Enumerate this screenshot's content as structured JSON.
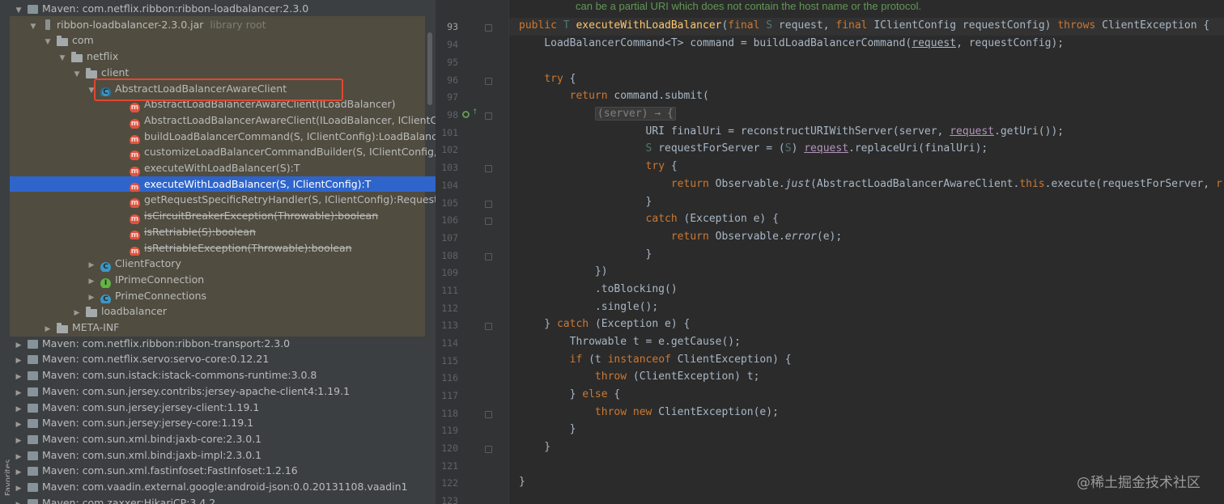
{
  "sidebar": {
    "favorites_label": "Favorites"
  },
  "tree": {
    "rows": [
      {
        "indent": 1,
        "arrow": "open",
        "icon": "maven",
        "text": "Maven: com.netflix.ribbon:ribbon-loadbalancer:2.3.0"
      },
      {
        "indent": 2,
        "arrow": "open",
        "icon": "jar",
        "text": "ribbon-loadbalancer-2.3.0.jar",
        "hint": "library root"
      },
      {
        "indent": 3,
        "arrow": "open",
        "icon": "folder",
        "text": "com"
      },
      {
        "indent": 4,
        "arrow": "open",
        "icon": "folder",
        "text": "netflix"
      },
      {
        "indent": 5,
        "arrow": "open",
        "icon": "folder",
        "text": "client"
      },
      {
        "indent": 6,
        "arrow": "open",
        "icon": "class-abstract",
        "text": "AbstractLoadBalancerAwareClient"
      },
      {
        "indent": 8,
        "arrow": "none",
        "icon": "method",
        "text": "AbstractLoadBalancerAwareClient(ILoadBalancer)"
      },
      {
        "indent": 8,
        "arrow": "none",
        "icon": "method",
        "text": "AbstractLoadBalancerAwareClient(ILoadBalancer, IClientConfig)"
      },
      {
        "indent": 8,
        "arrow": "none",
        "icon": "method",
        "text": "buildLoadBalancerCommand(S, IClientConfig):LoadBalancerCommand<T>"
      },
      {
        "indent": 8,
        "arrow": "none",
        "icon": "method",
        "text": "customizeLoadBalancerCommandBuilder(S, IClientConfig, Builder<T>):void"
      },
      {
        "indent": 8,
        "arrow": "none",
        "icon": "method",
        "text": "executeWithLoadBalancer(S):T"
      },
      {
        "indent": 8,
        "arrow": "none",
        "icon": "method",
        "text": "executeWithLoadBalancer(S, IClientConfig):T",
        "selected": true
      },
      {
        "indent": 8,
        "arrow": "none",
        "icon": "method",
        "text": "getRequestSpecificRetryHandler(S, IClientConfig):RequestSpecificRetryHandler"
      },
      {
        "indent": 8,
        "arrow": "none",
        "icon": "method",
        "text": "isCircuitBreakerException(Throwable):boolean",
        "deprecated": true
      },
      {
        "indent": 8,
        "arrow": "none",
        "icon": "method",
        "text": "isRetriable(S):boolean",
        "deprecated": true
      },
      {
        "indent": 8,
        "arrow": "none",
        "icon": "method",
        "text": "isRetriableException(Throwable):boolean",
        "deprecated": true
      },
      {
        "indent": 6,
        "arrow": "closed",
        "icon": "class",
        "text": "ClientFactory"
      },
      {
        "indent": 6,
        "arrow": "closed",
        "icon": "interface",
        "text": "IPrimeConnection"
      },
      {
        "indent": 6,
        "arrow": "closed",
        "icon": "class",
        "text": "PrimeConnections"
      },
      {
        "indent": 5,
        "arrow": "closed",
        "icon": "folder",
        "text": "loadbalancer"
      },
      {
        "indent": 3,
        "arrow": "closed",
        "icon": "folder",
        "text": "META-INF"
      },
      {
        "indent": 1,
        "arrow": "closed",
        "icon": "maven",
        "text": "Maven: com.netflix.ribbon:ribbon-transport:2.3.0"
      },
      {
        "indent": 1,
        "arrow": "closed",
        "icon": "maven",
        "text": "Maven: com.netflix.servo:servo-core:0.12.21"
      },
      {
        "indent": 1,
        "arrow": "closed",
        "icon": "maven",
        "text": "Maven: com.sun.istack:istack-commons-runtime:3.0.8"
      },
      {
        "indent": 1,
        "arrow": "closed",
        "icon": "maven",
        "text": "Maven: com.sun.jersey.contribs:jersey-apache-client4:1.19.1"
      },
      {
        "indent": 1,
        "arrow": "closed",
        "icon": "maven",
        "text": "Maven: com.sun.jersey:jersey-client:1.19.1"
      },
      {
        "indent": 1,
        "arrow": "closed",
        "icon": "maven",
        "text": "Maven: com.sun.jersey:jersey-core:1.19.1"
      },
      {
        "indent": 1,
        "arrow": "closed",
        "icon": "maven",
        "text": "Maven: com.sun.xml.bind:jaxb-core:2.3.0.1"
      },
      {
        "indent": 1,
        "arrow": "closed",
        "icon": "maven",
        "text": "Maven: com.sun.xml.bind:jaxb-impl:2.3.0.1"
      },
      {
        "indent": 1,
        "arrow": "closed",
        "icon": "maven",
        "text": "Maven: com.sun.xml.fastinfoset:FastInfoset:1.2.16"
      },
      {
        "indent": 1,
        "arrow": "closed",
        "icon": "maven",
        "text": "Maven: com.vaadin.external.google:android-json:0.0.20131108.vaadin1"
      },
      {
        "indent": 1,
        "arrow": "closed",
        "icon": "maven",
        "text": "Maven: com.zaxxer:HikariCP:3.4.2"
      }
    ]
  },
  "editor": {
    "doc_comment": "can be a partial URI which does not contain the host name or the protocol.",
    "line_numbers": [
      "93",
      "94",
      "95",
      "96",
      "97",
      "98",
      "101",
      "102",
      "103",
      "104",
      "105",
      "106",
      "107",
      "108",
      "109",
      "111",
      "112",
      "113",
      "114",
      "115",
      "116",
      "117",
      "118",
      "119",
      "120",
      "121",
      "122",
      "123"
    ],
    "lines": {
      "l93": {
        "a": "public ",
        "b": "T ",
        "c": "executeWithLoadBalancer",
        "d": "(",
        "e": "final ",
        "f": "S ",
        "g": "request, ",
        "h": "final ",
        "i": "IClientConfig requestConfig) ",
        "j": "throws ",
        "k": "ClientException {"
      },
      "l94": {
        "a": "    LoadBalancerCommand<T> command = buildLoadBalancerCommand(",
        "b": "request",
        "c": ", requestConfig);"
      },
      "l96": {
        "a": "    ",
        "b": "try ",
        "c": "{"
      },
      "l97": {
        "a": "        ",
        "b": "return ",
        "c": "command.submit("
      },
      "l98": {
        "a": "            ",
        "b": "(server) → {"
      },
      "l101": {
        "a": "                    URI finalUri = reconstructURIWithServer(server, ",
        "b": "request",
        ".": "",
        "c": ".getUri());"
      },
      "l102": {
        "a": "                    ",
        "b": "S ",
        "c": "requestForServer = (",
        "d": "S",
        "e": ") ",
        "f": "request",
        "g": ".replaceUri(finalUri);"
      },
      "l103": {
        "a": "                    ",
        "b": "try ",
        "c": "{"
      },
      "l104": {
        "a": "                        ",
        "b": "return ",
        "c": "Observable.",
        "d": "just",
        "e": "(AbstractLoadBalancerAwareClient.",
        "f": "this",
        ".": "",
        "g": ".execute(requestForServer, ",
        "h": "r"
      },
      "l105": {
        "a": "                    }"
      },
      "l106": {
        "a": "                    ",
        "b": "catch ",
        "c": "(Exception e) {"
      },
      "l107": {
        "a": "                        ",
        "b": "return ",
        "c": "Observable.",
        "d": "error",
        "e": "(e);"
      },
      "l108": {
        "a": "                    }"
      },
      "l109": {
        "a": "            })"
      },
      "l111": {
        "a": "            .toBlocking()"
      },
      "l112": {
        "a": "            .single();"
      },
      "l113": {
        "a": "    } ",
        "b": "catch ",
        "c": "(Exception e) {"
      },
      "l114": {
        "a": "        Throwable t = e.getCause();"
      },
      "l115": {
        "a": "        ",
        "b": "if ",
        "c": "(t ",
        "d": "instanceof ",
        "e": "ClientException) {"
      },
      "l116": {
        "a": "            ",
        "b": "throw ",
        "c": "(ClientException) t;"
      },
      "l117": {
        "a": "        } ",
        "b": "else ",
        "c": "{"
      },
      "l118": {
        "a": "            ",
        "b": "throw new ",
        "c": "ClientException(e);"
      },
      "l119": {
        "a": "        }"
      },
      "l120": {
        "a": "    }"
      },
      "l122": {
        "a": "}"
      }
    }
  },
  "watermark": "@稀土掘金技术社区",
  "colors": {
    "selection": "#2f65ca",
    "highlight_box": "#e2462f",
    "keyword": "#cc7832",
    "function": "#ffc66d",
    "doc_comment": "#629755"
  }
}
